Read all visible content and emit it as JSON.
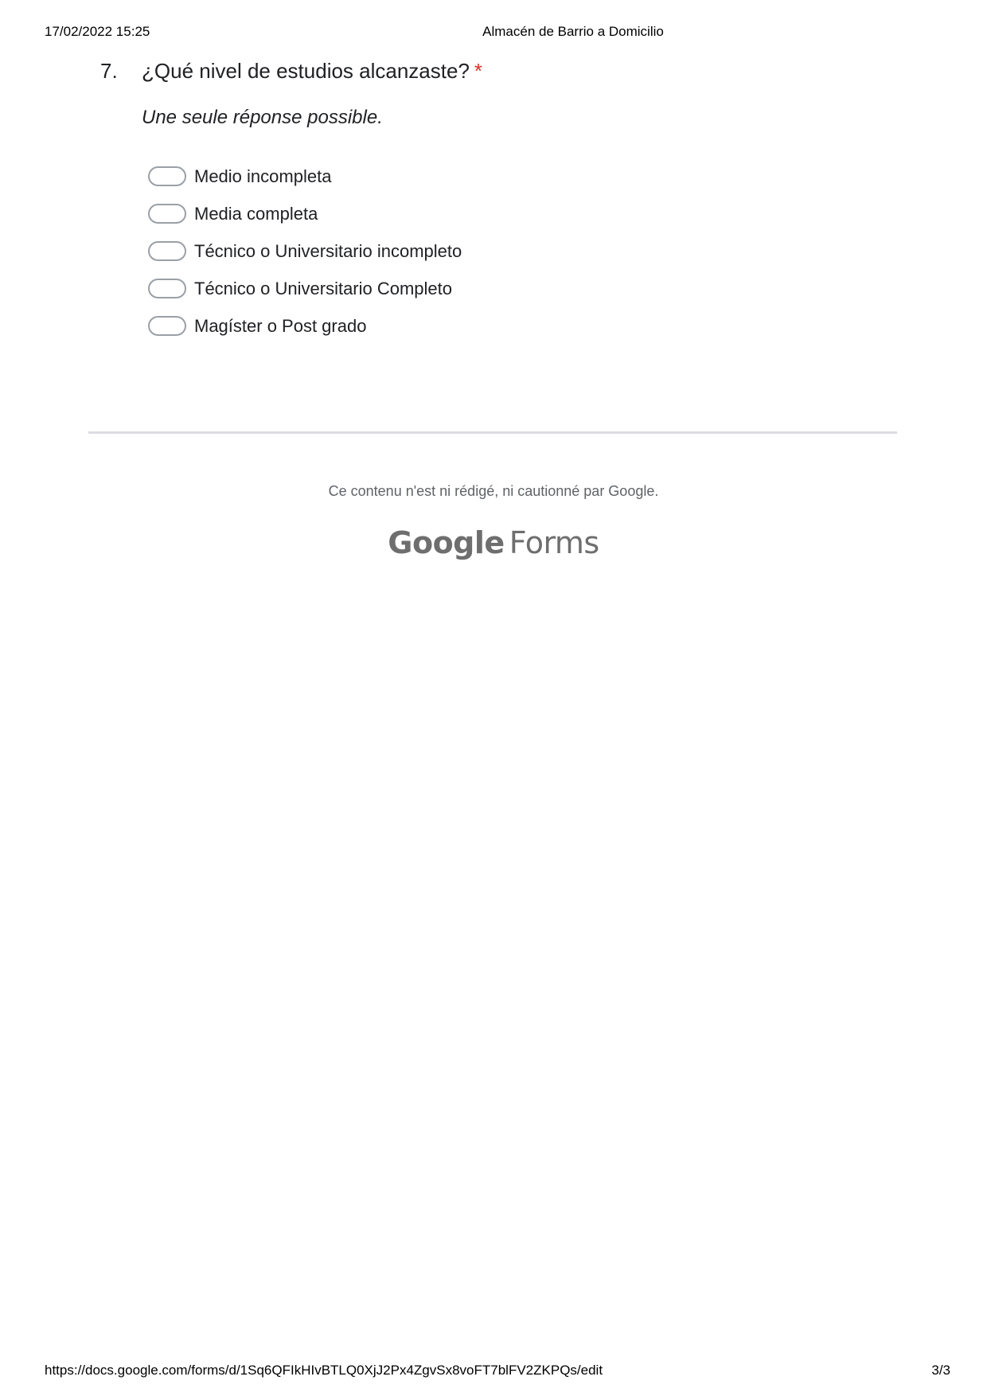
{
  "print_header": {
    "datetime": "17/02/2022 15:25",
    "title": "Almacén de Barrio a Domicilio"
  },
  "question": {
    "number": "7.",
    "title": "¿Qué nivel de estudios alcanzaste?",
    "required_marker": "*",
    "hint": "Une seule réponse possible.",
    "options": [
      "Medio incompleta",
      "Media completa",
      "Técnico o Universitario incompleto",
      "Técnico o Universitario Completo",
      "Magíster o Post grado"
    ]
  },
  "footer": {
    "disclaimer": "Ce contenu n'est ni rédigé, ni cautionné par Google.",
    "logo_google": "Google",
    "logo_forms": "Forms"
  },
  "print_footer": {
    "url": "https://docs.google.com/forms/d/1Sq6QFIkHIvBTLQ0XjJ2Px4ZgvSx8voFT7blFV2ZKPQs/edit",
    "page": "3/3"
  }
}
